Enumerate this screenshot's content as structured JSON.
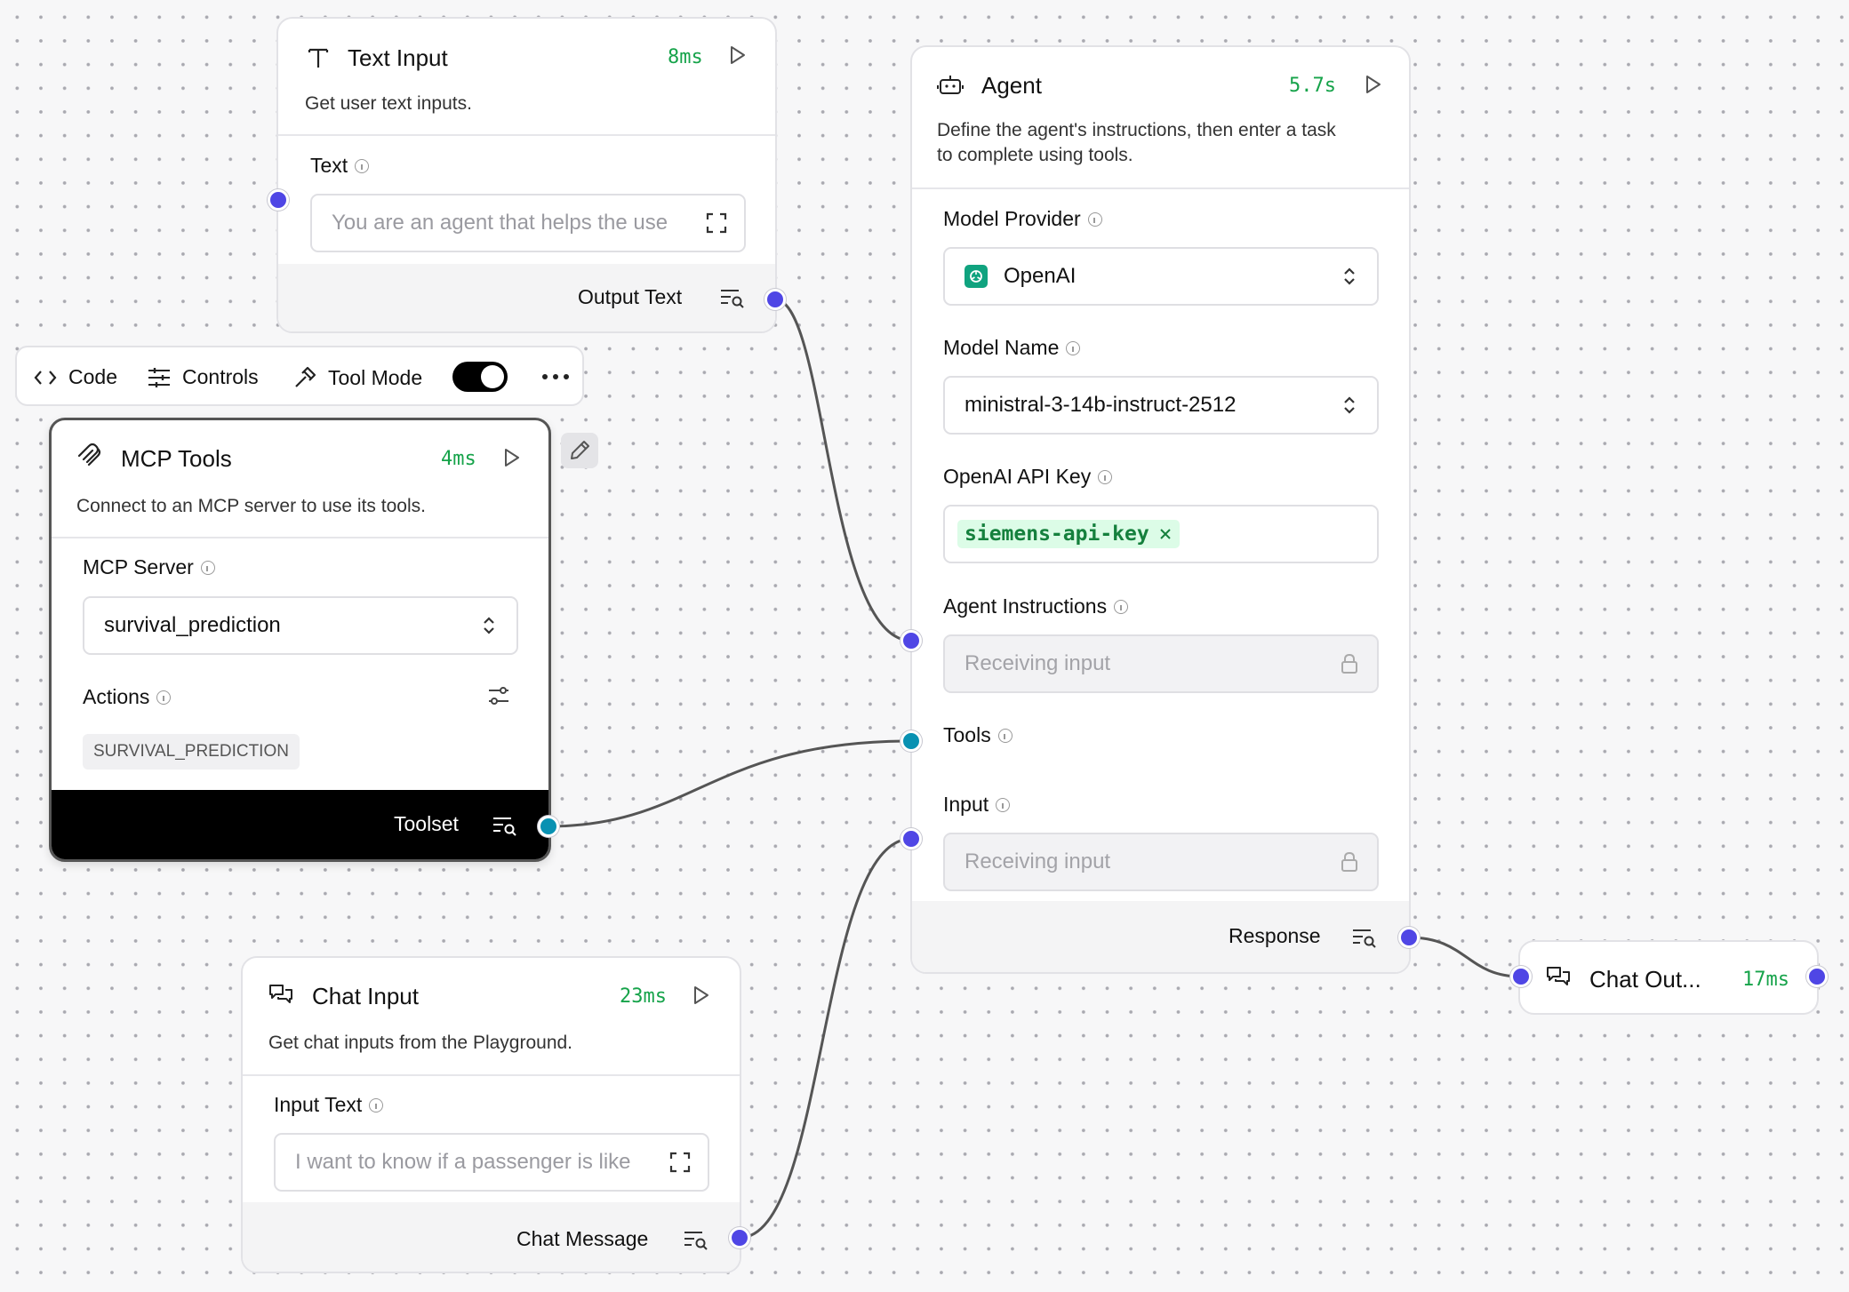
{
  "text_input": {
    "title": "Text Input",
    "time": "8ms",
    "description": "Get user text inputs.",
    "field_label": "Text",
    "field_value": "You are an agent that helps the use",
    "output_label": "Output Text"
  },
  "toolbar": {
    "code_label": "Code",
    "controls_label": "Controls",
    "tool_mode_label": "Tool Mode",
    "tool_mode_on": true
  },
  "mcp_tools": {
    "title": "MCP Tools",
    "time": "4ms",
    "description": "Connect to an MCP server to use its tools.",
    "server_label": "MCP Server",
    "server_value": "survival_prediction",
    "actions_label": "Actions",
    "action_tag": "SURVIVAL_PREDICTION",
    "output_label": "Toolset"
  },
  "chat_input": {
    "title": "Chat Input",
    "time": "23ms",
    "description": "Get chat inputs from the Playground.",
    "field_label": "Input Text",
    "field_value": "I want to know if a passenger is like",
    "output_label": "Chat Message"
  },
  "agent": {
    "title": "Agent",
    "time": "5.7s",
    "description_line1": "Define the agent's instructions, then enter a task",
    "description_line2": "to complete using tools.",
    "model_provider_label": "Model Provider",
    "model_provider_value": "OpenAI",
    "model_name_label": "Model Name",
    "model_name_value": "ministral-3-14b-instruct-2512",
    "api_key_label": "OpenAI API Key",
    "api_key_value": "siemens-api-key",
    "instructions_label": "Agent Instructions",
    "instructions_placeholder": "Receiving input",
    "tools_label": "Tools",
    "input_label": "Input",
    "input_placeholder": "Receiving input",
    "output_label": "Response"
  },
  "chat_output": {
    "title": "Chat Out...",
    "time": "17ms"
  },
  "colors": {
    "accent": "#4f46e5",
    "tool_handle": "#0891b2",
    "time": "#16a34a",
    "key_tag_bg": "#dcfce7",
    "key_tag_text": "#15803d"
  }
}
